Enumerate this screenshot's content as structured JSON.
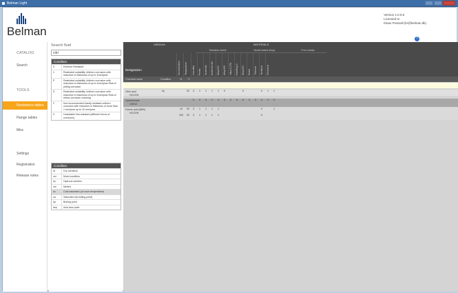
{
  "window": {
    "title": "Belman Light"
  },
  "header": {
    "logo_text": "Belman",
    "version": "Version 1.0.0.6",
    "licensed_label": "Licensed to",
    "licensee": "Klaus Prasvall (kr@belman.dk)"
  },
  "sidebar": {
    "items": [
      {
        "label": "CATALOG",
        "section": true
      },
      {
        "label": "Search"
      },
      {
        "label": "TOOLS",
        "section": true
      },
      {
        "label": "Resistance tables",
        "active": true
      },
      {
        "label": "Flange tables"
      },
      {
        "label": "Misc"
      },
      {
        "label": "Settings"
      },
      {
        "label": "Registration"
      },
      {
        "label": "Release notes"
      }
    ]
  },
  "search": {
    "label": "Search fluid",
    "value": "citri"
  },
  "legend1": {
    "title": "Condition",
    "rows": [
      {
        "code": "0",
        "desc": "Extreme Resistant"
      },
      {
        "code": "1",
        "desc": "Restricted suitability Uniform corrosion with reduction in thickness of up to 1mm/year"
      },
      {
        "code": "P",
        "desc": "Restricted suitability Uniform corrosion with reduction in thickness of up to 1mm/year Risk of pitting corrosion"
      },
      {
        "code": "S",
        "desc": "Restricted suitability Uniform corrosion with reduction in thickness of up to 1mm/year Risk of stress corrosion cracking"
      },
      {
        "code": "2",
        "desc": "Not recommended Hardly resistant uniform corrosion with reduction in thickness of more than 1 mm/year up to 10 mm/year"
      },
      {
        "code": "3",
        "desc": "Unsuitable Not resistant (different forms of corrosion)"
      }
    ]
  },
  "legend2": {
    "title": "Condition",
    "rows": [
      {
        "code": "dr",
        "desc": "Dry condition"
      },
      {
        "code": "mo",
        "desc": "Moist condition"
      },
      {
        "code": "hy",
        "desc": "Hydrous solution"
      },
      {
        "code": "me",
        "desc": "Melted"
      },
      {
        "code": "cs",
        "desc": "Cold saturated (at room temperature)"
      },
      {
        "code": "sa",
        "desc": "Saturated (at boiling point)"
      },
      {
        "code": "bp",
        "desc": "Boiling point"
      },
      {
        "code": "dep",
        "desc": "Acid dew point"
      }
    ]
  },
  "table": {
    "group_medium": "MEDIUM",
    "group_materials": "MATERIALS",
    "sub_stainless": "Stainless steels",
    "sub_nickel": "Nickel-based alloys",
    "sub_pure": "Pure metals",
    "designation": "Designation",
    "col_chemical": "Chemical name",
    "col_condition": "Condition",
    "col_pct": "%",
    "col_temp": "°C",
    "vheaders": [
      "Concentration",
      "Temperature",
      "Low alloy",
      "Ferritic",
      "Austenitic",
      "Austenitic Mo",
      "Alloy 600",
      "Alloy 625",
      "Alloy C-276",
      "Hastelloy C",
      "Alloy 800",
      "Nickel",
      "Titanium",
      "Tantalum",
      "Zirconium"
    ],
    "rows": [
      {
        "name": "Citric acid",
        "formula": "HCOOH",
        "cond": "hy",
        "pct": "",
        "temp": "20",
        "vals": [
          "3",
          "1",
          "1",
          "1",
          "1",
          "0",
          "",
          "",
          "0",
          "",
          "",
          "0",
          "1",
          "1"
        ]
      },
      {
        "name": "Cyclohexane",
        "formula": "C6H12",
        "cond": "",
        "pct": "",
        "temp": "",
        "vals": [
          "0",
          "0",
          "0",
          "0",
          "0",
          "0",
          "0",
          "0",
          "0",
          "0",
          "0",
          "0",
          "0",
          "0"
        ]
      },
      {
        "name": "Formic acid (85%)",
        "formula": "HCOOH",
        "cond": "",
        "pct": "10",
        "temp": "20",
        "vals": [
          "3",
          "1",
          "1",
          "1",
          "1",
          "",
          "",
          "",
          "",
          "",
          "",
          "0",
          "",
          "1"
        ]
      },
      {
        "name": "",
        "formula": "",
        "cond": "",
        "pct": "100",
        "temp": "20",
        "vals": [
          "3",
          "1",
          "1",
          "1",
          "1",
          "",
          "",
          "",
          "",
          "",
          "",
          "0",
          "",
          ""
        ]
      }
    ]
  }
}
